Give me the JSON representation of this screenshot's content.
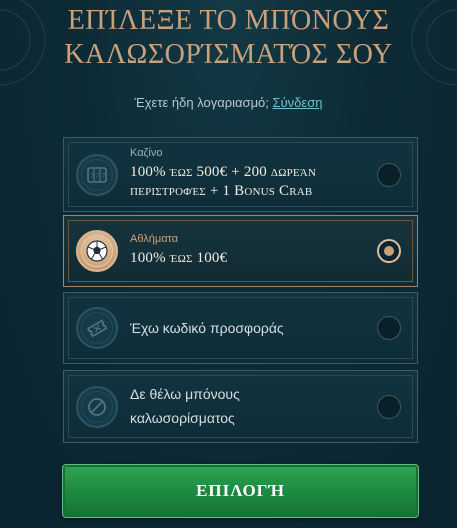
{
  "title": {
    "line1": "Επίλεξε το μπόνους",
    "line2": "καλωσορίσματός σου"
  },
  "login": {
    "prompt": "Έχετε ήδη λογαριασμό;",
    "link": "Σύνδεση"
  },
  "options": [
    {
      "icon": "slot-machine-icon",
      "category": "Καζίνο",
      "line1": "100% έως 500€ + 200 δωρεάν",
      "line2": "περιστροφές + 1 Bonus Crab",
      "selected": false
    },
    {
      "icon": "soccer-ball-icon",
      "category": "Αθλήματα",
      "line1": "100% έως 100€",
      "selected": true
    },
    {
      "icon": "ticket-icon",
      "text": "Έχω κωδικό προσφοράς",
      "selected": false
    },
    {
      "icon": "no-bonus-icon",
      "line1": "Δε θέλω μπόνους",
      "line2": "καλωσορίσματος",
      "selected": false
    }
  ],
  "cta": {
    "label": "Επιλογή"
  },
  "colors": {
    "background": "#0d2b35",
    "gold": "#c9a27c",
    "link": "#6fc3d0",
    "cta_green": "#1d8a40"
  }
}
